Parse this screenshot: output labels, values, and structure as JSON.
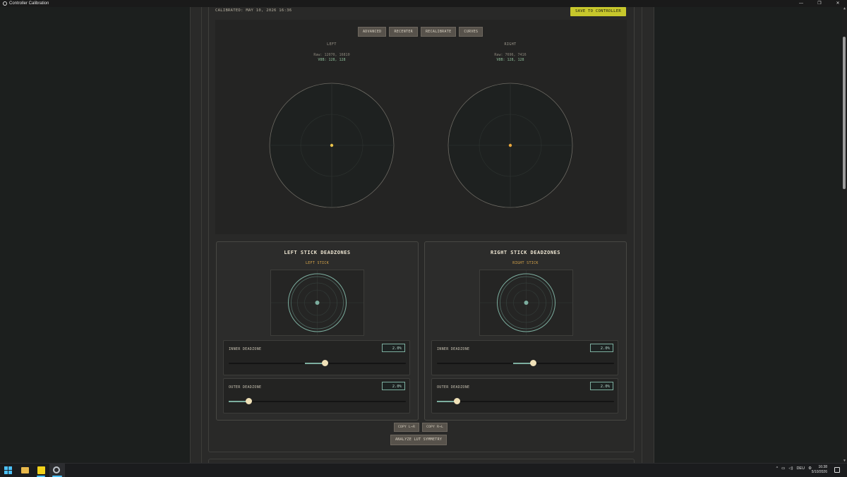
{
  "window": {
    "title": "Controller Calibration",
    "controls": [
      "—",
      "❐",
      "✕"
    ]
  },
  "header": {
    "calibrated_text": "CALIBRATED: MAY 10, 2026 16:36",
    "save_button": "SAVE TO CONTROLLER"
  },
  "toolbar": {
    "buttons": [
      "ADVANCED",
      "RECENTER",
      "RECALIBRATE",
      "CURVES"
    ]
  },
  "sticks": {
    "left": {
      "label": "LEFT",
      "raw": "Raw: 12070, 16810",
      "vector": "V8B: 128, 128"
    },
    "right": {
      "label": "RIGHT",
      "raw": "Raw: 7696, 7416",
      "vector": "V8B: 128, 128"
    }
  },
  "deadzones": {
    "left": {
      "title": "LEFT STICK DEADZONES",
      "subtitle": "LEFT STICK",
      "inner": {
        "label": "INNER DEADZONE",
        "value": "2.0%",
        "position": 0.54
      },
      "outer": {
        "label": "OUTER DEADZONE",
        "value": "2.0%",
        "position": 0.11
      }
    },
    "right": {
      "title": "RIGHT STICK DEADZONES",
      "subtitle": "RIGHT STICK",
      "inner": {
        "label": "INNER DEADZONE",
        "value": "2.0%",
        "position": 0.54
      },
      "outer": {
        "label": "OUTER DEADZONE",
        "value": "2.0%",
        "position": 0.11
      }
    }
  },
  "actions": {
    "copy_l_r": "COPY L→R",
    "copy_r_l": "COPY R→L",
    "analyze": "ANALYZE LUT SYMMETRY"
  },
  "taskbar": {
    "language": "DEU",
    "time": "16:38",
    "date": "5/10/2026"
  },
  "colors": {
    "accent": "#c8c82c",
    "stick_dot": "#e8b84b",
    "deadzone_ring": "#7cae9f",
    "subtitle": "#d9a64b"
  }
}
